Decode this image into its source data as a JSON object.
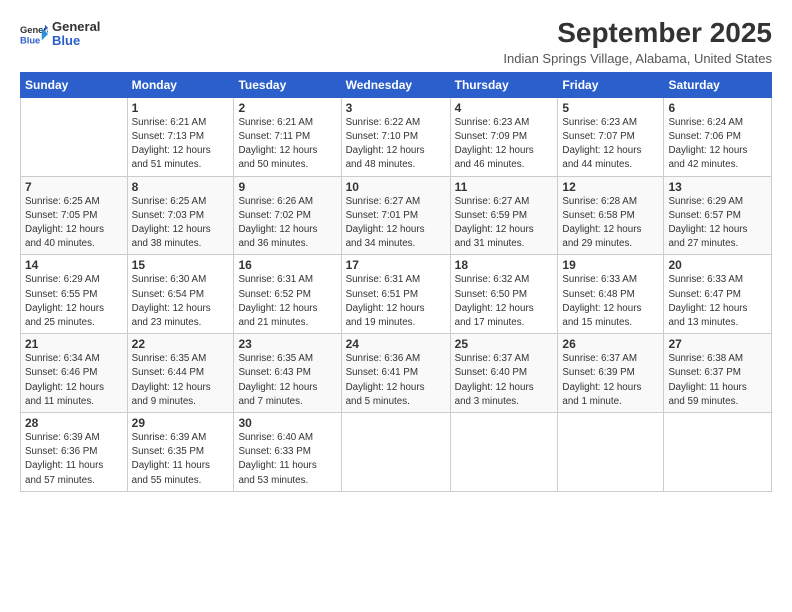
{
  "logo": {
    "general": "General",
    "blue": "Blue"
  },
  "header": {
    "month": "September 2025",
    "location": "Indian Springs Village, Alabama, United States"
  },
  "days_header": [
    "Sunday",
    "Monday",
    "Tuesday",
    "Wednesday",
    "Thursday",
    "Friday",
    "Saturday"
  ],
  "weeks": [
    [
      {
        "num": "",
        "info": ""
      },
      {
        "num": "1",
        "info": "Sunrise: 6:21 AM\nSunset: 7:13 PM\nDaylight: 12 hours\nand 51 minutes."
      },
      {
        "num": "2",
        "info": "Sunrise: 6:21 AM\nSunset: 7:11 PM\nDaylight: 12 hours\nand 50 minutes."
      },
      {
        "num": "3",
        "info": "Sunrise: 6:22 AM\nSunset: 7:10 PM\nDaylight: 12 hours\nand 48 minutes."
      },
      {
        "num": "4",
        "info": "Sunrise: 6:23 AM\nSunset: 7:09 PM\nDaylight: 12 hours\nand 46 minutes."
      },
      {
        "num": "5",
        "info": "Sunrise: 6:23 AM\nSunset: 7:07 PM\nDaylight: 12 hours\nand 44 minutes."
      },
      {
        "num": "6",
        "info": "Sunrise: 6:24 AM\nSunset: 7:06 PM\nDaylight: 12 hours\nand 42 minutes."
      }
    ],
    [
      {
        "num": "7",
        "info": "Sunrise: 6:25 AM\nSunset: 7:05 PM\nDaylight: 12 hours\nand 40 minutes."
      },
      {
        "num": "8",
        "info": "Sunrise: 6:25 AM\nSunset: 7:03 PM\nDaylight: 12 hours\nand 38 minutes."
      },
      {
        "num": "9",
        "info": "Sunrise: 6:26 AM\nSunset: 7:02 PM\nDaylight: 12 hours\nand 36 minutes."
      },
      {
        "num": "10",
        "info": "Sunrise: 6:27 AM\nSunset: 7:01 PM\nDaylight: 12 hours\nand 34 minutes."
      },
      {
        "num": "11",
        "info": "Sunrise: 6:27 AM\nSunset: 6:59 PM\nDaylight: 12 hours\nand 31 minutes."
      },
      {
        "num": "12",
        "info": "Sunrise: 6:28 AM\nSunset: 6:58 PM\nDaylight: 12 hours\nand 29 minutes."
      },
      {
        "num": "13",
        "info": "Sunrise: 6:29 AM\nSunset: 6:57 PM\nDaylight: 12 hours\nand 27 minutes."
      }
    ],
    [
      {
        "num": "14",
        "info": "Sunrise: 6:29 AM\nSunset: 6:55 PM\nDaylight: 12 hours\nand 25 minutes."
      },
      {
        "num": "15",
        "info": "Sunrise: 6:30 AM\nSunset: 6:54 PM\nDaylight: 12 hours\nand 23 minutes."
      },
      {
        "num": "16",
        "info": "Sunrise: 6:31 AM\nSunset: 6:52 PM\nDaylight: 12 hours\nand 21 minutes."
      },
      {
        "num": "17",
        "info": "Sunrise: 6:31 AM\nSunset: 6:51 PM\nDaylight: 12 hours\nand 19 minutes."
      },
      {
        "num": "18",
        "info": "Sunrise: 6:32 AM\nSunset: 6:50 PM\nDaylight: 12 hours\nand 17 minutes."
      },
      {
        "num": "19",
        "info": "Sunrise: 6:33 AM\nSunset: 6:48 PM\nDaylight: 12 hours\nand 15 minutes."
      },
      {
        "num": "20",
        "info": "Sunrise: 6:33 AM\nSunset: 6:47 PM\nDaylight: 12 hours\nand 13 minutes."
      }
    ],
    [
      {
        "num": "21",
        "info": "Sunrise: 6:34 AM\nSunset: 6:46 PM\nDaylight: 12 hours\nand 11 minutes."
      },
      {
        "num": "22",
        "info": "Sunrise: 6:35 AM\nSunset: 6:44 PM\nDaylight: 12 hours\nand 9 minutes."
      },
      {
        "num": "23",
        "info": "Sunrise: 6:35 AM\nSunset: 6:43 PM\nDaylight: 12 hours\nand 7 minutes."
      },
      {
        "num": "24",
        "info": "Sunrise: 6:36 AM\nSunset: 6:41 PM\nDaylight: 12 hours\nand 5 minutes."
      },
      {
        "num": "25",
        "info": "Sunrise: 6:37 AM\nSunset: 6:40 PM\nDaylight: 12 hours\nand 3 minutes."
      },
      {
        "num": "26",
        "info": "Sunrise: 6:37 AM\nSunset: 6:39 PM\nDaylight: 12 hours\nand 1 minute."
      },
      {
        "num": "27",
        "info": "Sunrise: 6:38 AM\nSunset: 6:37 PM\nDaylight: 11 hours\nand 59 minutes."
      }
    ],
    [
      {
        "num": "28",
        "info": "Sunrise: 6:39 AM\nSunset: 6:36 PM\nDaylight: 11 hours\nand 57 minutes."
      },
      {
        "num": "29",
        "info": "Sunrise: 6:39 AM\nSunset: 6:35 PM\nDaylight: 11 hours\nand 55 minutes."
      },
      {
        "num": "30",
        "info": "Sunrise: 6:40 AM\nSunset: 6:33 PM\nDaylight: 11 hours\nand 53 minutes."
      },
      {
        "num": "",
        "info": ""
      },
      {
        "num": "",
        "info": ""
      },
      {
        "num": "",
        "info": ""
      },
      {
        "num": "",
        "info": ""
      }
    ]
  ]
}
